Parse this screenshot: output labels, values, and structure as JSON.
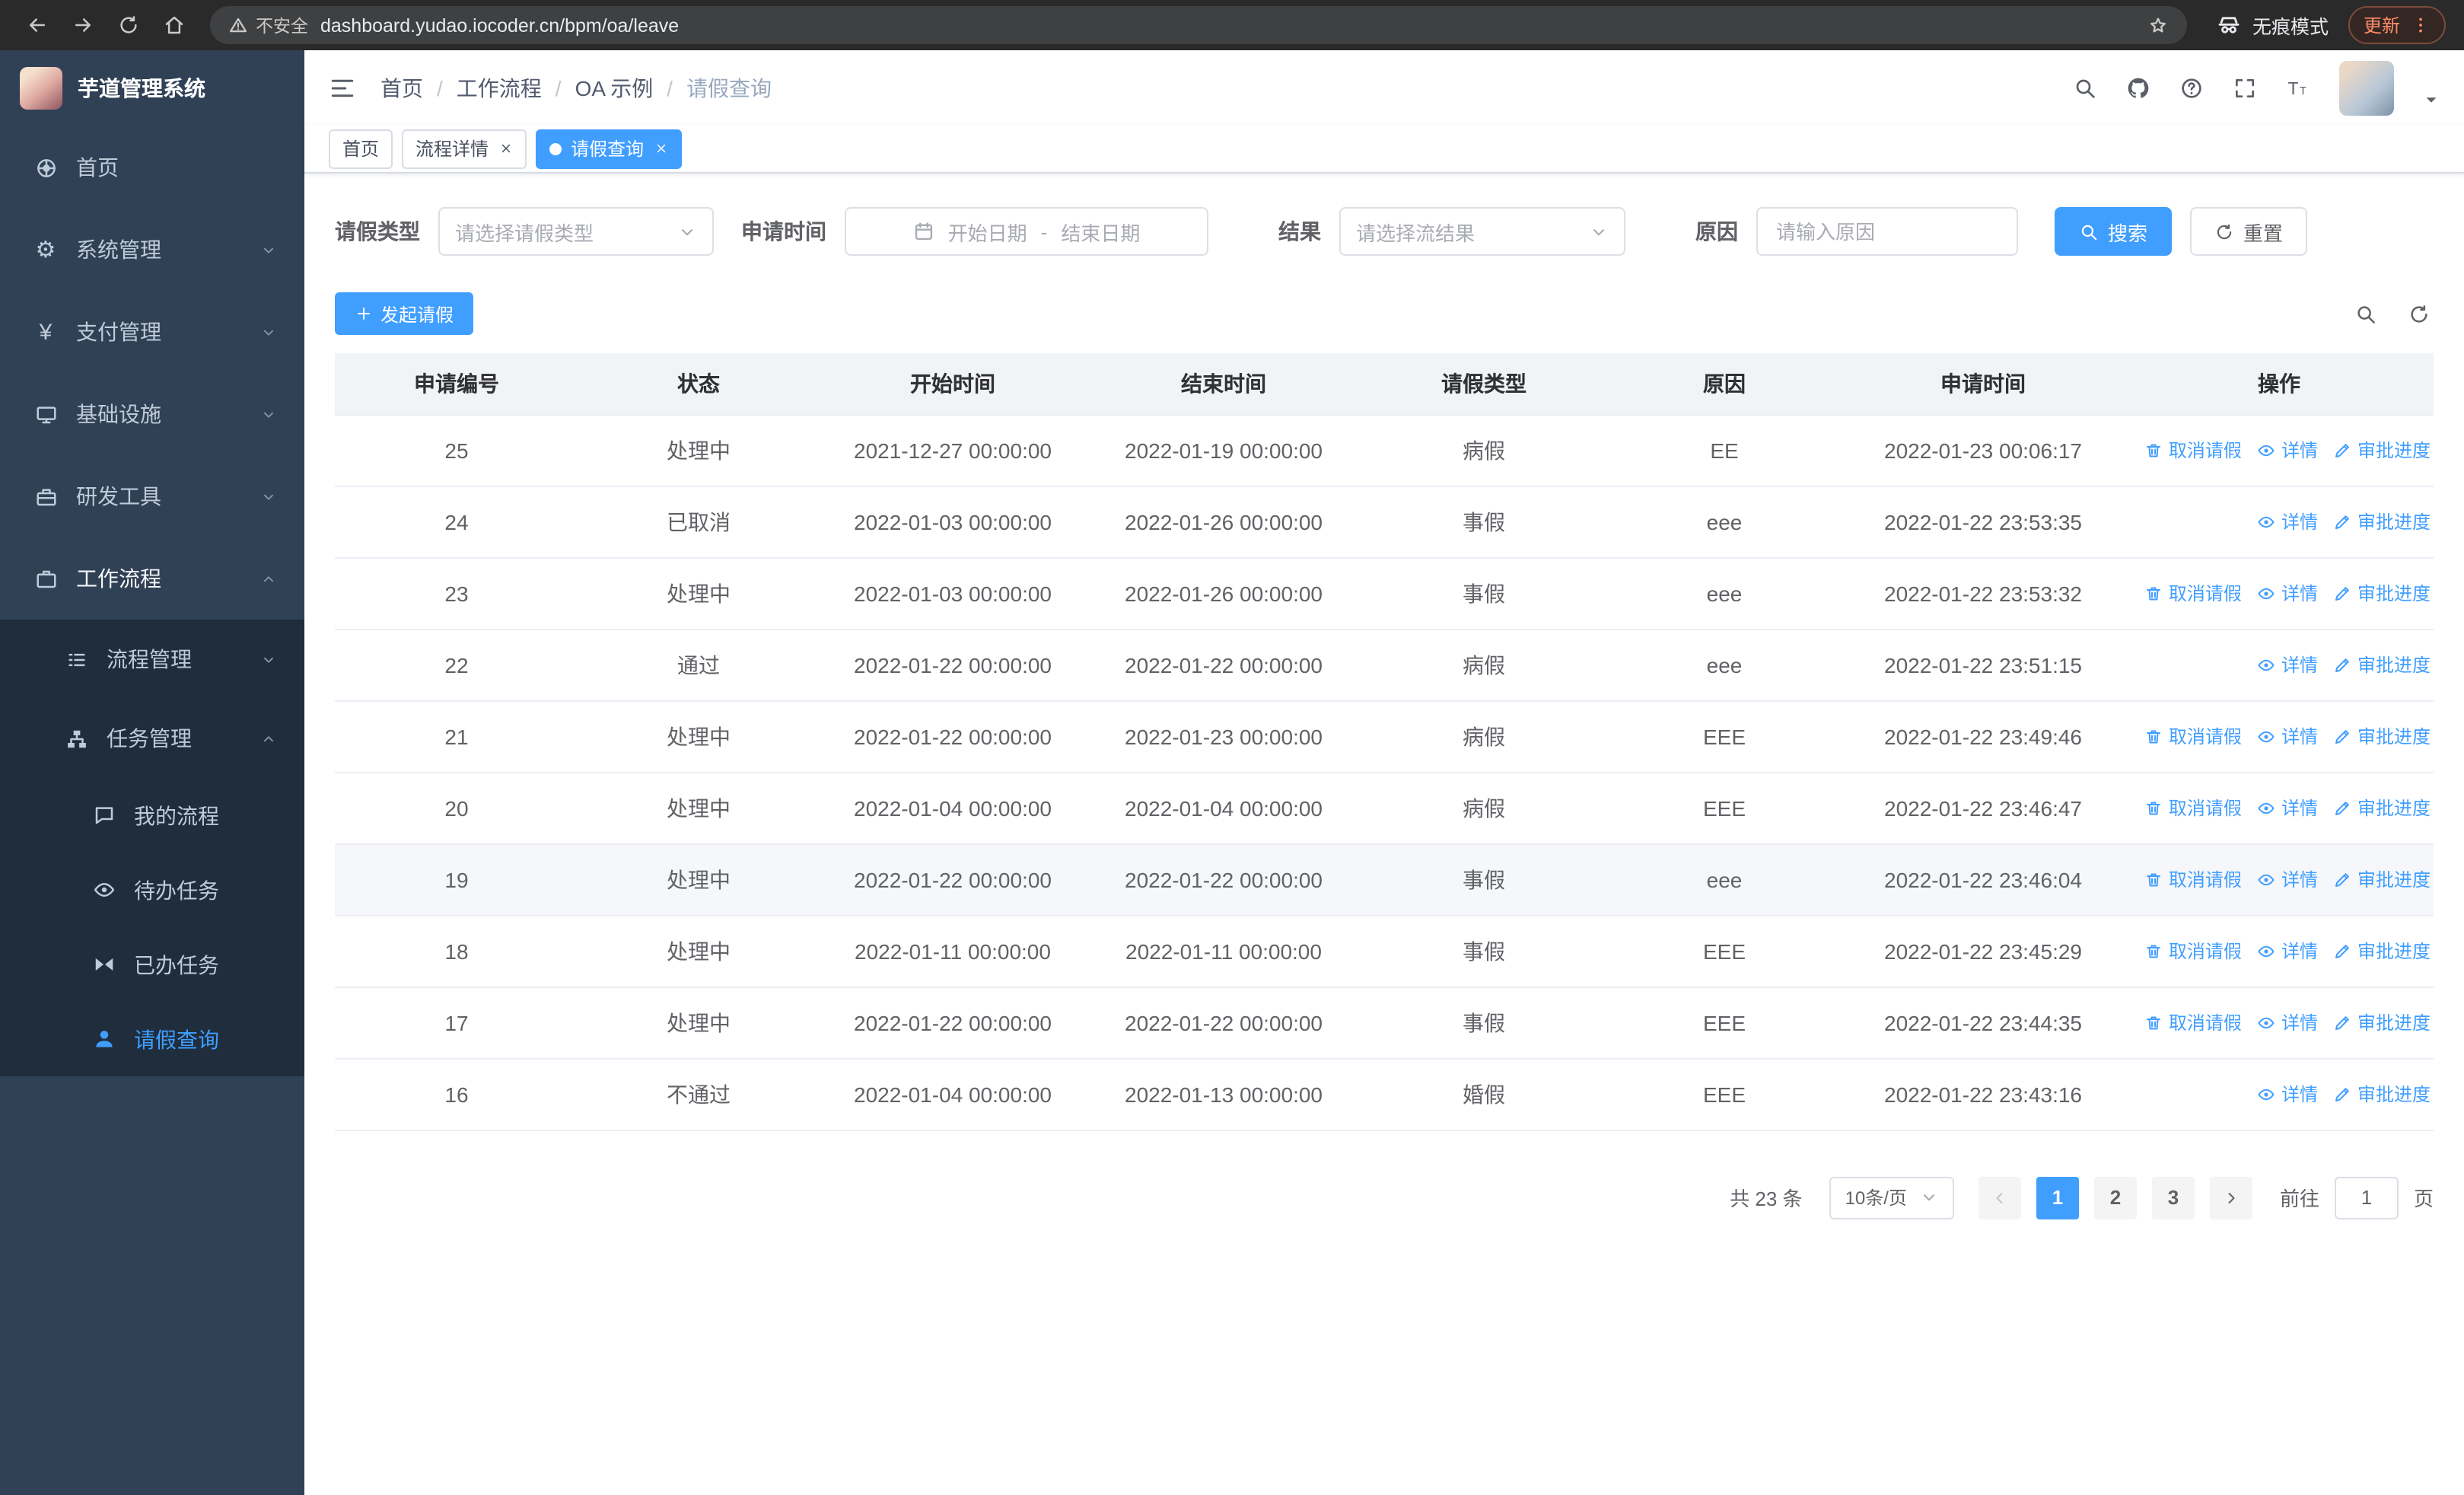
{
  "theme": {
    "primary": "#409eff",
    "sidebar_bg": "#304156",
    "sidebar_submenu_bg": "#1f2d3d"
  },
  "browser": {
    "security_label": "不安全",
    "url": "dashboard.yudao.iocoder.cn/bpm/oa/leave",
    "incognito_label": "无痕模式",
    "update_label": "更新"
  },
  "sidebar": {
    "title": "芋道管理系统",
    "items": [
      {
        "label": "首页",
        "icon": "dashboard-icon",
        "state": "none"
      },
      {
        "label": "系统管理",
        "icon": "gear-icon",
        "state": "collapsed"
      },
      {
        "label": "支付管理",
        "icon": "yen-icon",
        "state": "collapsed"
      },
      {
        "label": "基础设施",
        "icon": "monitor-icon",
        "state": "collapsed"
      },
      {
        "label": "研发工具",
        "icon": "toolbox-icon",
        "state": "collapsed"
      },
      {
        "label": "工作流程",
        "icon": "briefcase-icon",
        "state": "expanded"
      }
    ],
    "workflow_children": [
      {
        "label": "流程管理",
        "icon": "list-icon",
        "state": "collapsed"
      },
      {
        "label": "任务管理",
        "icon": "tree-icon",
        "state": "expanded"
      }
    ],
    "task_children": [
      {
        "label": "我的流程",
        "icon": "chat-icon",
        "active": false
      },
      {
        "label": "待办任务",
        "icon": "eye-icon",
        "active": false
      },
      {
        "label": "已办任务",
        "icon": "bowtie-icon",
        "active": false
      },
      {
        "label": "请假查询",
        "icon": "user-icon",
        "active": true
      }
    ]
  },
  "breadcrumb": [
    "首页",
    "工作流程",
    "OA 示例",
    "请假查询"
  ],
  "tabs": [
    {
      "label": "首页",
      "closable": false,
      "active": false
    },
    {
      "label": "流程详情",
      "closable": true,
      "active": false
    },
    {
      "label": "请假查询",
      "closable": true,
      "active": true
    }
  ],
  "filters": {
    "leave_type_label": "请假类型",
    "leave_type_placeholder": "请选择请假类型",
    "apply_time_label": "申请时间",
    "start_placeholder": "开始日期",
    "range_separator": "-",
    "end_placeholder": "结束日期",
    "result_label": "结果",
    "result_placeholder": "请选择流结果",
    "reason_label": "原因",
    "reason_placeholder": "请输入原因",
    "search_label": "搜索",
    "reset_label": "重置"
  },
  "toolbar": {
    "create_label": "发起请假"
  },
  "table": {
    "columns": [
      "申请编号",
      "状态",
      "开始时间",
      "结束时间",
      "请假类型",
      "原因",
      "申请时间",
      "操作"
    ],
    "action_labels": {
      "cancel": "取消请假",
      "detail": "详情",
      "progress": "审批进度"
    },
    "rows": [
      {
        "id": "25",
        "status": "处理中",
        "start_time": "2021-12-27 00:00:00",
        "end_time": "2022-01-19 00:00:00",
        "leave_type": "病假",
        "reason": "EE",
        "apply_time": "2022-01-23 00:06:17",
        "actions": [
          "cancel",
          "detail",
          "progress"
        ]
      },
      {
        "id": "24",
        "status": "已取消",
        "start_time": "2022-01-03 00:00:00",
        "end_time": "2022-01-26 00:00:00",
        "leave_type": "事假",
        "reason": "eee",
        "apply_time": "2022-01-22 23:53:35",
        "actions": [
          "detail",
          "progress"
        ]
      },
      {
        "id": "23",
        "status": "处理中",
        "start_time": "2022-01-03 00:00:00",
        "end_time": "2022-01-26 00:00:00",
        "leave_type": "事假",
        "reason": "eee",
        "apply_time": "2022-01-22 23:53:32",
        "actions": [
          "cancel",
          "detail",
          "progress"
        ]
      },
      {
        "id": "22",
        "status": "通过",
        "start_time": "2022-01-22 00:00:00",
        "end_time": "2022-01-22 00:00:00",
        "leave_type": "病假",
        "reason": "eee",
        "apply_time": "2022-01-22 23:51:15",
        "actions": [
          "detail",
          "progress"
        ]
      },
      {
        "id": "21",
        "status": "处理中",
        "start_time": "2022-01-22 00:00:00",
        "end_time": "2022-01-23 00:00:00",
        "leave_type": "病假",
        "reason": "EEE",
        "apply_time": "2022-01-22 23:49:46",
        "actions": [
          "cancel",
          "detail",
          "progress"
        ]
      },
      {
        "id": "20",
        "status": "处理中",
        "start_time": "2022-01-04 00:00:00",
        "end_time": "2022-01-04 00:00:00",
        "leave_type": "病假",
        "reason": "EEE",
        "apply_time": "2022-01-22 23:46:47",
        "actions": [
          "cancel",
          "detail",
          "progress"
        ]
      },
      {
        "id": "19",
        "status": "处理中",
        "start_time": "2022-01-22 00:00:00",
        "end_time": "2022-01-22 00:00:00",
        "leave_type": "事假",
        "reason": "eee",
        "apply_time": "2022-01-22 23:46:04",
        "actions": [
          "cancel",
          "detail",
          "progress"
        ],
        "highlighted": true
      },
      {
        "id": "18",
        "status": "处理中",
        "start_time": "2022-01-11 00:00:00",
        "end_time": "2022-01-11 00:00:00",
        "leave_type": "事假",
        "reason": "EEE",
        "apply_time": "2022-01-22 23:45:29",
        "actions": [
          "cancel",
          "detail",
          "progress"
        ]
      },
      {
        "id": "17",
        "status": "处理中",
        "start_time": "2022-01-22 00:00:00",
        "end_time": "2022-01-22 00:00:00",
        "leave_type": "事假",
        "reason": "EEE",
        "apply_time": "2022-01-22 23:44:35",
        "actions": [
          "cancel",
          "detail",
          "progress"
        ]
      },
      {
        "id": "16",
        "status": "不通过",
        "start_time": "2022-01-04 00:00:00",
        "end_time": "2022-01-13 00:00:00",
        "leave_type": "婚假",
        "reason": "EEE",
        "apply_time": "2022-01-22 23:43:16",
        "actions": [
          "detail",
          "progress"
        ]
      }
    ]
  },
  "pagination": {
    "total_label": "共 23 条",
    "page_size_label": "10条/页",
    "pages": [
      "1",
      "2",
      "3"
    ],
    "active_page": "1",
    "goto_label": "前往",
    "goto_value": "1",
    "unit_label": "页"
  }
}
